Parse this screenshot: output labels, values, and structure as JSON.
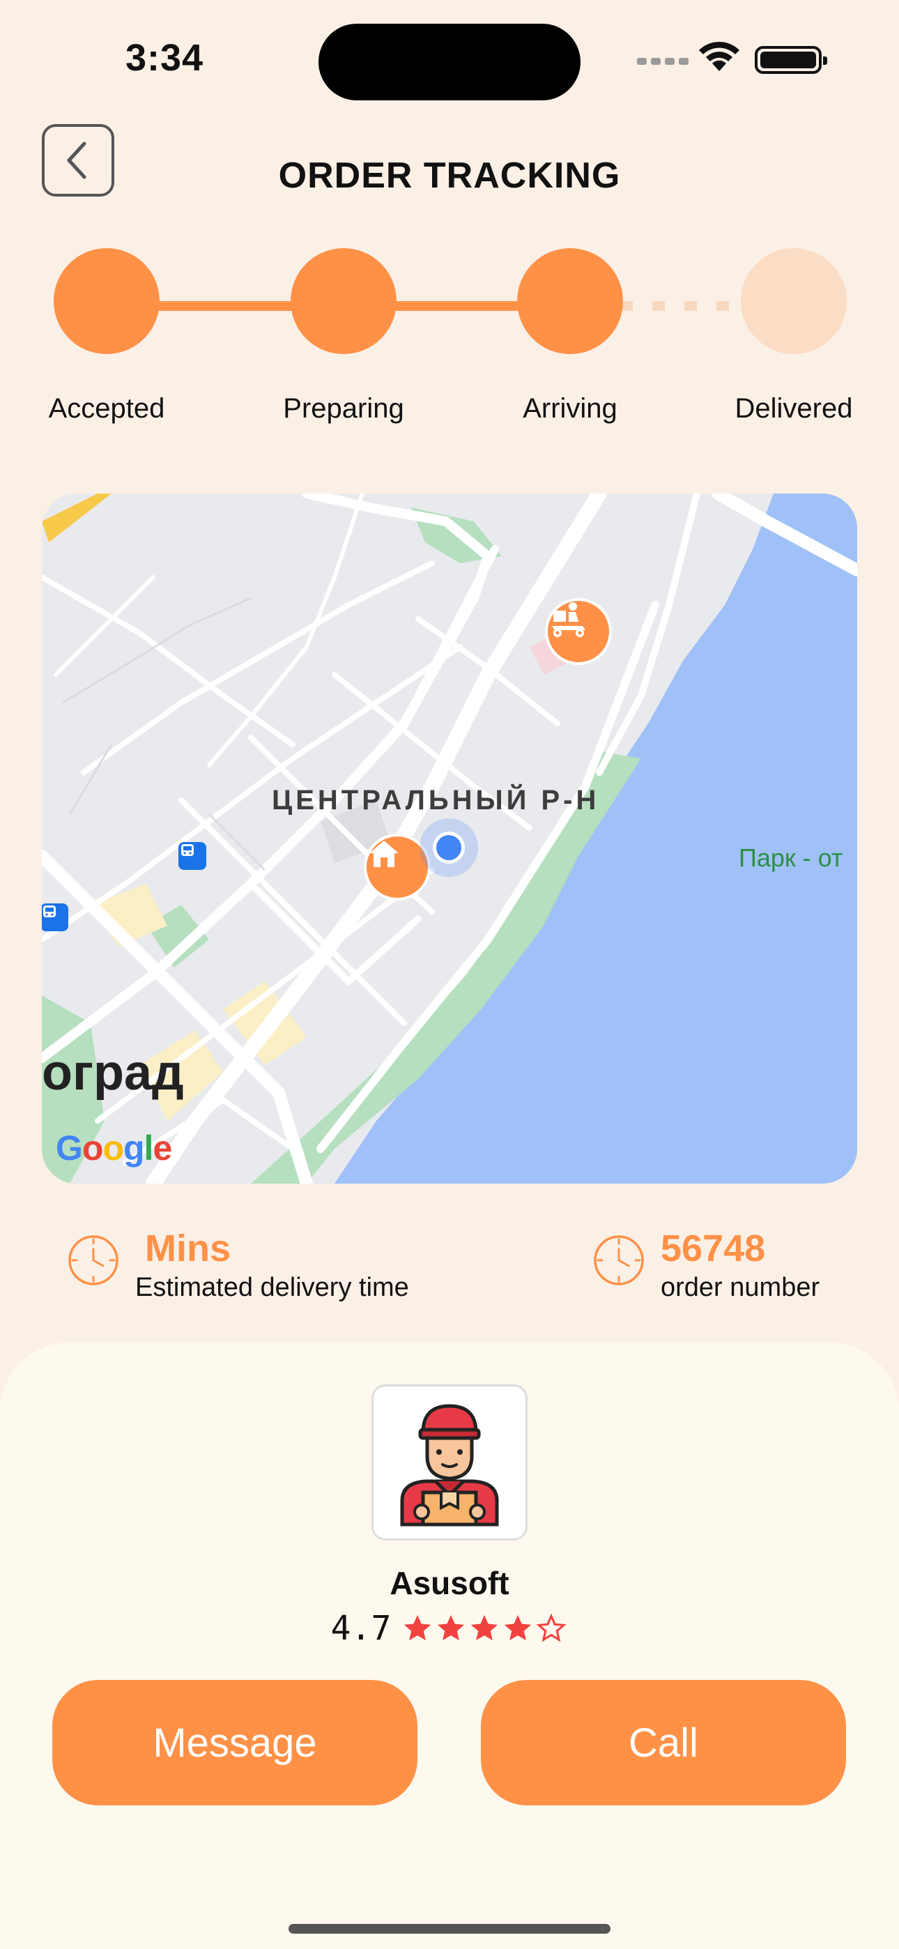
{
  "status_bar": {
    "time": "3:34"
  },
  "header": {
    "title": "ORDER TRACKING",
    "back_icon": "chevron-left-icon"
  },
  "steps": [
    {
      "label": "Accepted",
      "done": true
    },
    {
      "label": "Preparing",
      "done": true
    },
    {
      "label": "Arriving",
      "done": true
    },
    {
      "label": "Delivered",
      "done": false
    }
  ],
  "map": {
    "district_label": "ЦЕНТРАЛЬНЫЙ Р-Н",
    "park_label": "Парк - от",
    "city_label": "оград",
    "logo": {
      "g": "G",
      "o1": "o",
      "o2": "o",
      "g2": "g",
      "l": "l",
      "e": "e"
    }
  },
  "info": {
    "eta_value": "Mins",
    "eta_caption": "Estimated delivery time",
    "order_value": "56748",
    "order_caption": "order number"
  },
  "driver": {
    "name": "Asusoft",
    "rating": "4.7",
    "stars_filled": 4,
    "stars_total": 5
  },
  "actions": {
    "message_label": "Message",
    "call_label": "Call"
  },
  "colors": {
    "accent": "#ff9147",
    "background": "#fbf0e6",
    "sheet": "#fef9ee",
    "star": "#f2423f"
  }
}
